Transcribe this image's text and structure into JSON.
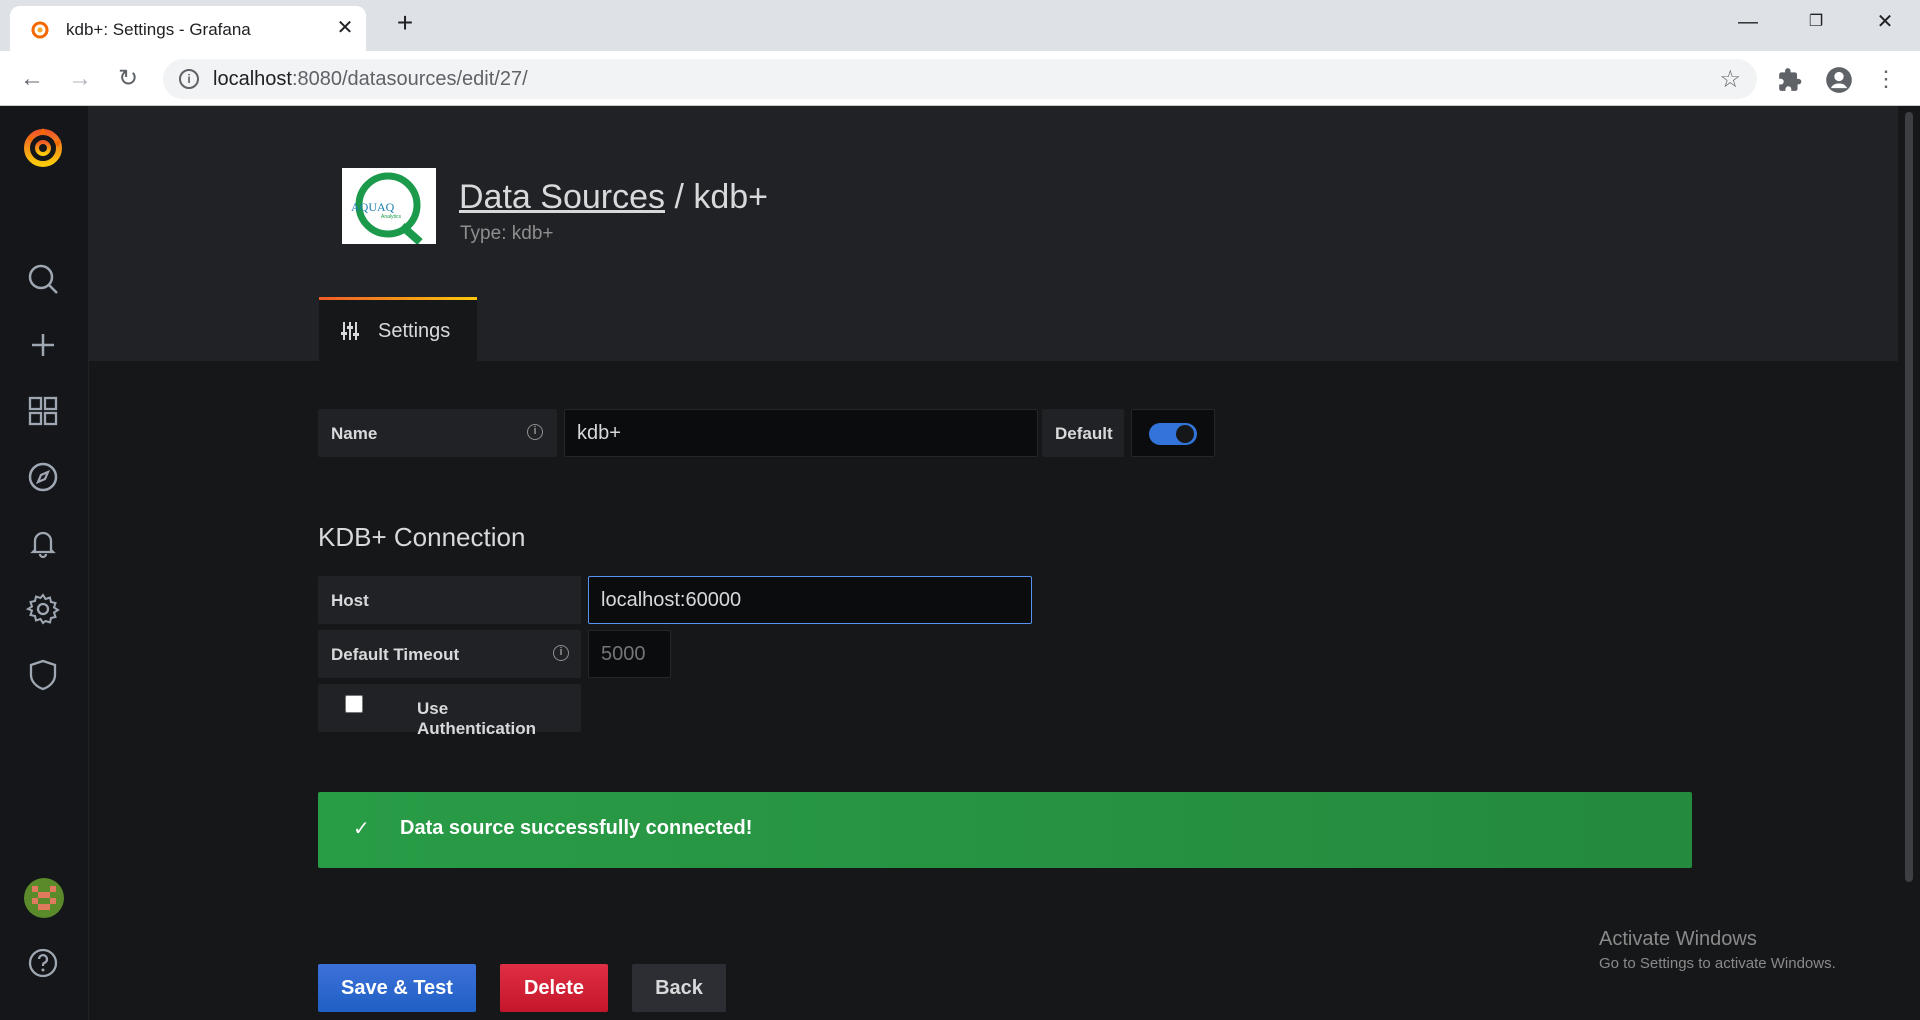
{
  "browser": {
    "tab_title": "kdb+: Settings - Grafana",
    "url_host": "localhost",
    "url_rest": ":8080/datasources/edit/27/"
  },
  "header": {
    "breadcrumb_link": "Data Sources",
    "separator": "/",
    "ds_name": "kdb+",
    "subtitle": "Type: kdb+",
    "logo_text": "AQUAQ",
    "logo_subtext": "Analytics"
  },
  "tabs": [
    {
      "label": "Settings",
      "icon": "sliders-icon",
      "active": true
    }
  ],
  "basic": {
    "name_label": "Name",
    "name_value": "kdb+",
    "default_label": "Default",
    "default_on": true
  },
  "connection": {
    "title": "KDB+ Connection",
    "host_label": "Host",
    "host_value": "localhost:60000",
    "timeout_label": "Default Timeout",
    "timeout_placeholder": "5000",
    "auth_label": "Use Authentication",
    "auth_checked": false
  },
  "alert": {
    "text": "Data source successfully connected!",
    "color": "#299c46"
  },
  "buttons": {
    "save": "Save & Test",
    "delete": "Delete",
    "back": "Back"
  },
  "watermark": {
    "line1": "Activate Windows",
    "line2": "Go to Settings to activate Windows."
  },
  "sidebar": [
    {
      "icon": "search-icon"
    },
    {
      "icon": "plus-icon"
    },
    {
      "icon": "dashboards-icon"
    },
    {
      "icon": "explore-icon"
    },
    {
      "icon": "bell-icon"
    },
    {
      "icon": "gear-icon"
    },
    {
      "icon": "shield-icon"
    },
    {
      "icon": "avatar"
    },
    {
      "icon": "help-icon"
    }
  ],
  "colors": {
    "accent": "#3274d9",
    "danger": "#e02f44",
    "success": "#299c46",
    "bg": "#161719"
  }
}
